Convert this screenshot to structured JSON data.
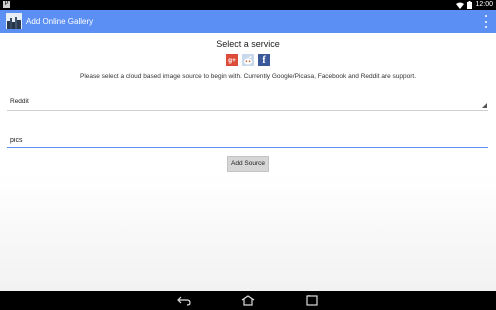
{
  "status_bar": {
    "left_icon": "P",
    "time": "12:00",
    "icons": [
      "wifi-icon",
      "battery-icon"
    ]
  },
  "action_bar": {
    "title": "Add Online Gallery",
    "app_icon": "gallery-app-icon",
    "overflow_icon": "overflow-menu-icon",
    "color": "#5b8ff3"
  },
  "main": {
    "heading": "Select a service",
    "services": [
      {
        "name": "google-plus",
        "glyph": "g+",
        "color": "#dd4b39"
      },
      {
        "name": "reddit",
        "glyph": "◉",
        "color": "#c9d9ec"
      },
      {
        "name": "facebook",
        "glyph": "f",
        "color": "#3b5998"
      }
    ],
    "info_text": "Please select a cloud based image source to begin with. Currently Google/Picasa, Facebook and Reddit are support.",
    "source_select": {
      "value": "Reddit"
    },
    "subreddit_input": {
      "value": "pics"
    },
    "add_button_label": "Add Source"
  },
  "nav_bar": {
    "buttons": [
      "back-icon",
      "home-icon",
      "recents-icon"
    ]
  }
}
